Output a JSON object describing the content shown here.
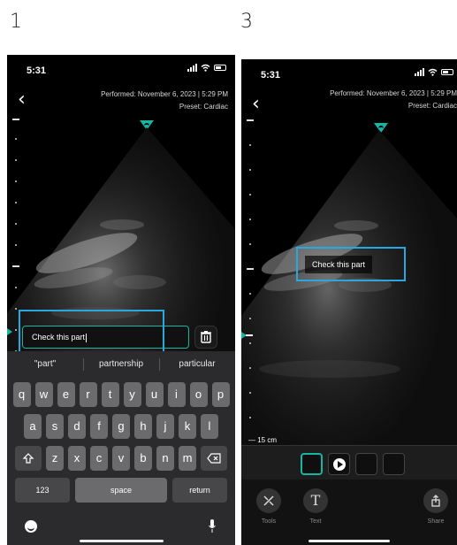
{
  "steps": {
    "left": "1",
    "right": "3"
  },
  "status": {
    "time": "5:31"
  },
  "exam": {
    "performed": "Performed: November 6, 2023 | 5:29 PM",
    "preset": "Preset: Cardiac"
  },
  "annotation": {
    "text": "Check this part"
  },
  "keyboard": {
    "suggestions": [
      "\"part\"",
      "partnership",
      "particular"
    ],
    "row1": [
      "q",
      "w",
      "e",
      "r",
      "t",
      "y",
      "u",
      "i",
      "o",
      "p"
    ],
    "row2": [
      "a",
      "s",
      "d",
      "f",
      "g",
      "h",
      "j",
      "k",
      "l"
    ],
    "row3": [
      "z",
      "x",
      "c",
      "v",
      "b",
      "n",
      "m"
    ],
    "numbers_label": "123",
    "space_label": "space",
    "return_label": "return"
  },
  "viewer": {
    "depth": "15 cm",
    "tools_label": "Tools",
    "text_label": "Text",
    "share_label": "Share",
    "text_tool_glyph": "T"
  },
  "colors": {
    "accent": "#16b6a5",
    "highlight": "#29a7e1"
  },
  "icons": [
    "back-chevron-icon",
    "probe-orientation-icon",
    "trash-icon",
    "emoji-icon",
    "microphone-icon",
    "shift-icon",
    "backspace-icon",
    "play-icon",
    "tools-icon",
    "text-icon",
    "share-icon"
  ]
}
